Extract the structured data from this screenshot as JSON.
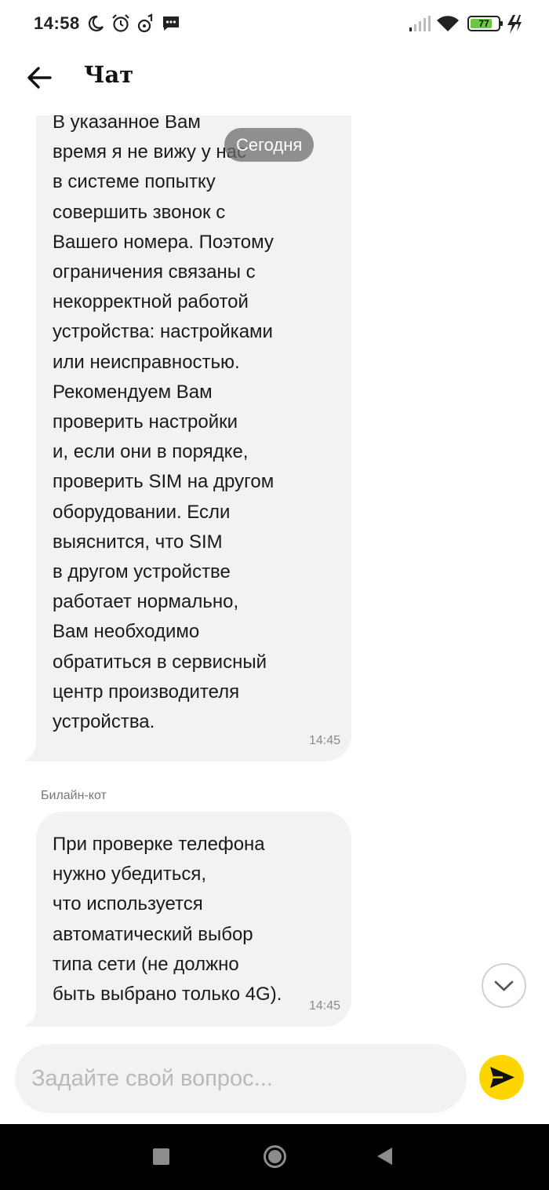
{
  "status_bar": {
    "time": "14:58",
    "battery_level": "77",
    "icons": [
      "moon-icon",
      "alarm-icon",
      "music-icon",
      "message-icon",
      "signal-icon",
      "wifi-icon",
      "battery-icon",
      "charging-icon"
    ]
  },
  "header": {
    "title": "Чат",
    "back_icon": "arrow-left-icon"
  },
  "chat": {
    "date_label": "Сегодня",
    "messages": [
      {
        "sender": "",
        "text": "В указанное Вам\nвремя я не вижу у нас\nв системе попытку\nсовершить звонок с\nВашего номера. Поэтому\nограничения связаны с\nнекорректной работой\nустройства: настройками\nили неисправностью.\nРекомендуем Вам\nпроверить настройки\nи, если они в порядке,\nпроверить SIM на другом\nоборудовании. Если\nвыяснится, что SIM\nв другом устройстве\nработает нормально,\nВам необходимо\nобратиться в сервисный\nцентр производителя\nустройства.",
        "time": "14:45"
      },
      {
        "sender": "Билайн-кот",
        "text": "При проверке телефона\nнужно убедиться,\nчто используется\nавтоматический выбор\nтипа сети (не должно\nбыть выбрано только 4G).",
        "time": "14:45"
      }
    ],
    "scroll_down_icon": "chevron-down-icon"
  },
  "composer": {
    "placeholder": "Задайте свой вопрос...",
    "value": "",
    "send_icon": "send-icon",
    "send_color": "#ffd500"
  },
  "nav_bar": {
    "icons": [
      "recents-icon",
      "home-icon",
      "back-icon"
    ]
  }
}
